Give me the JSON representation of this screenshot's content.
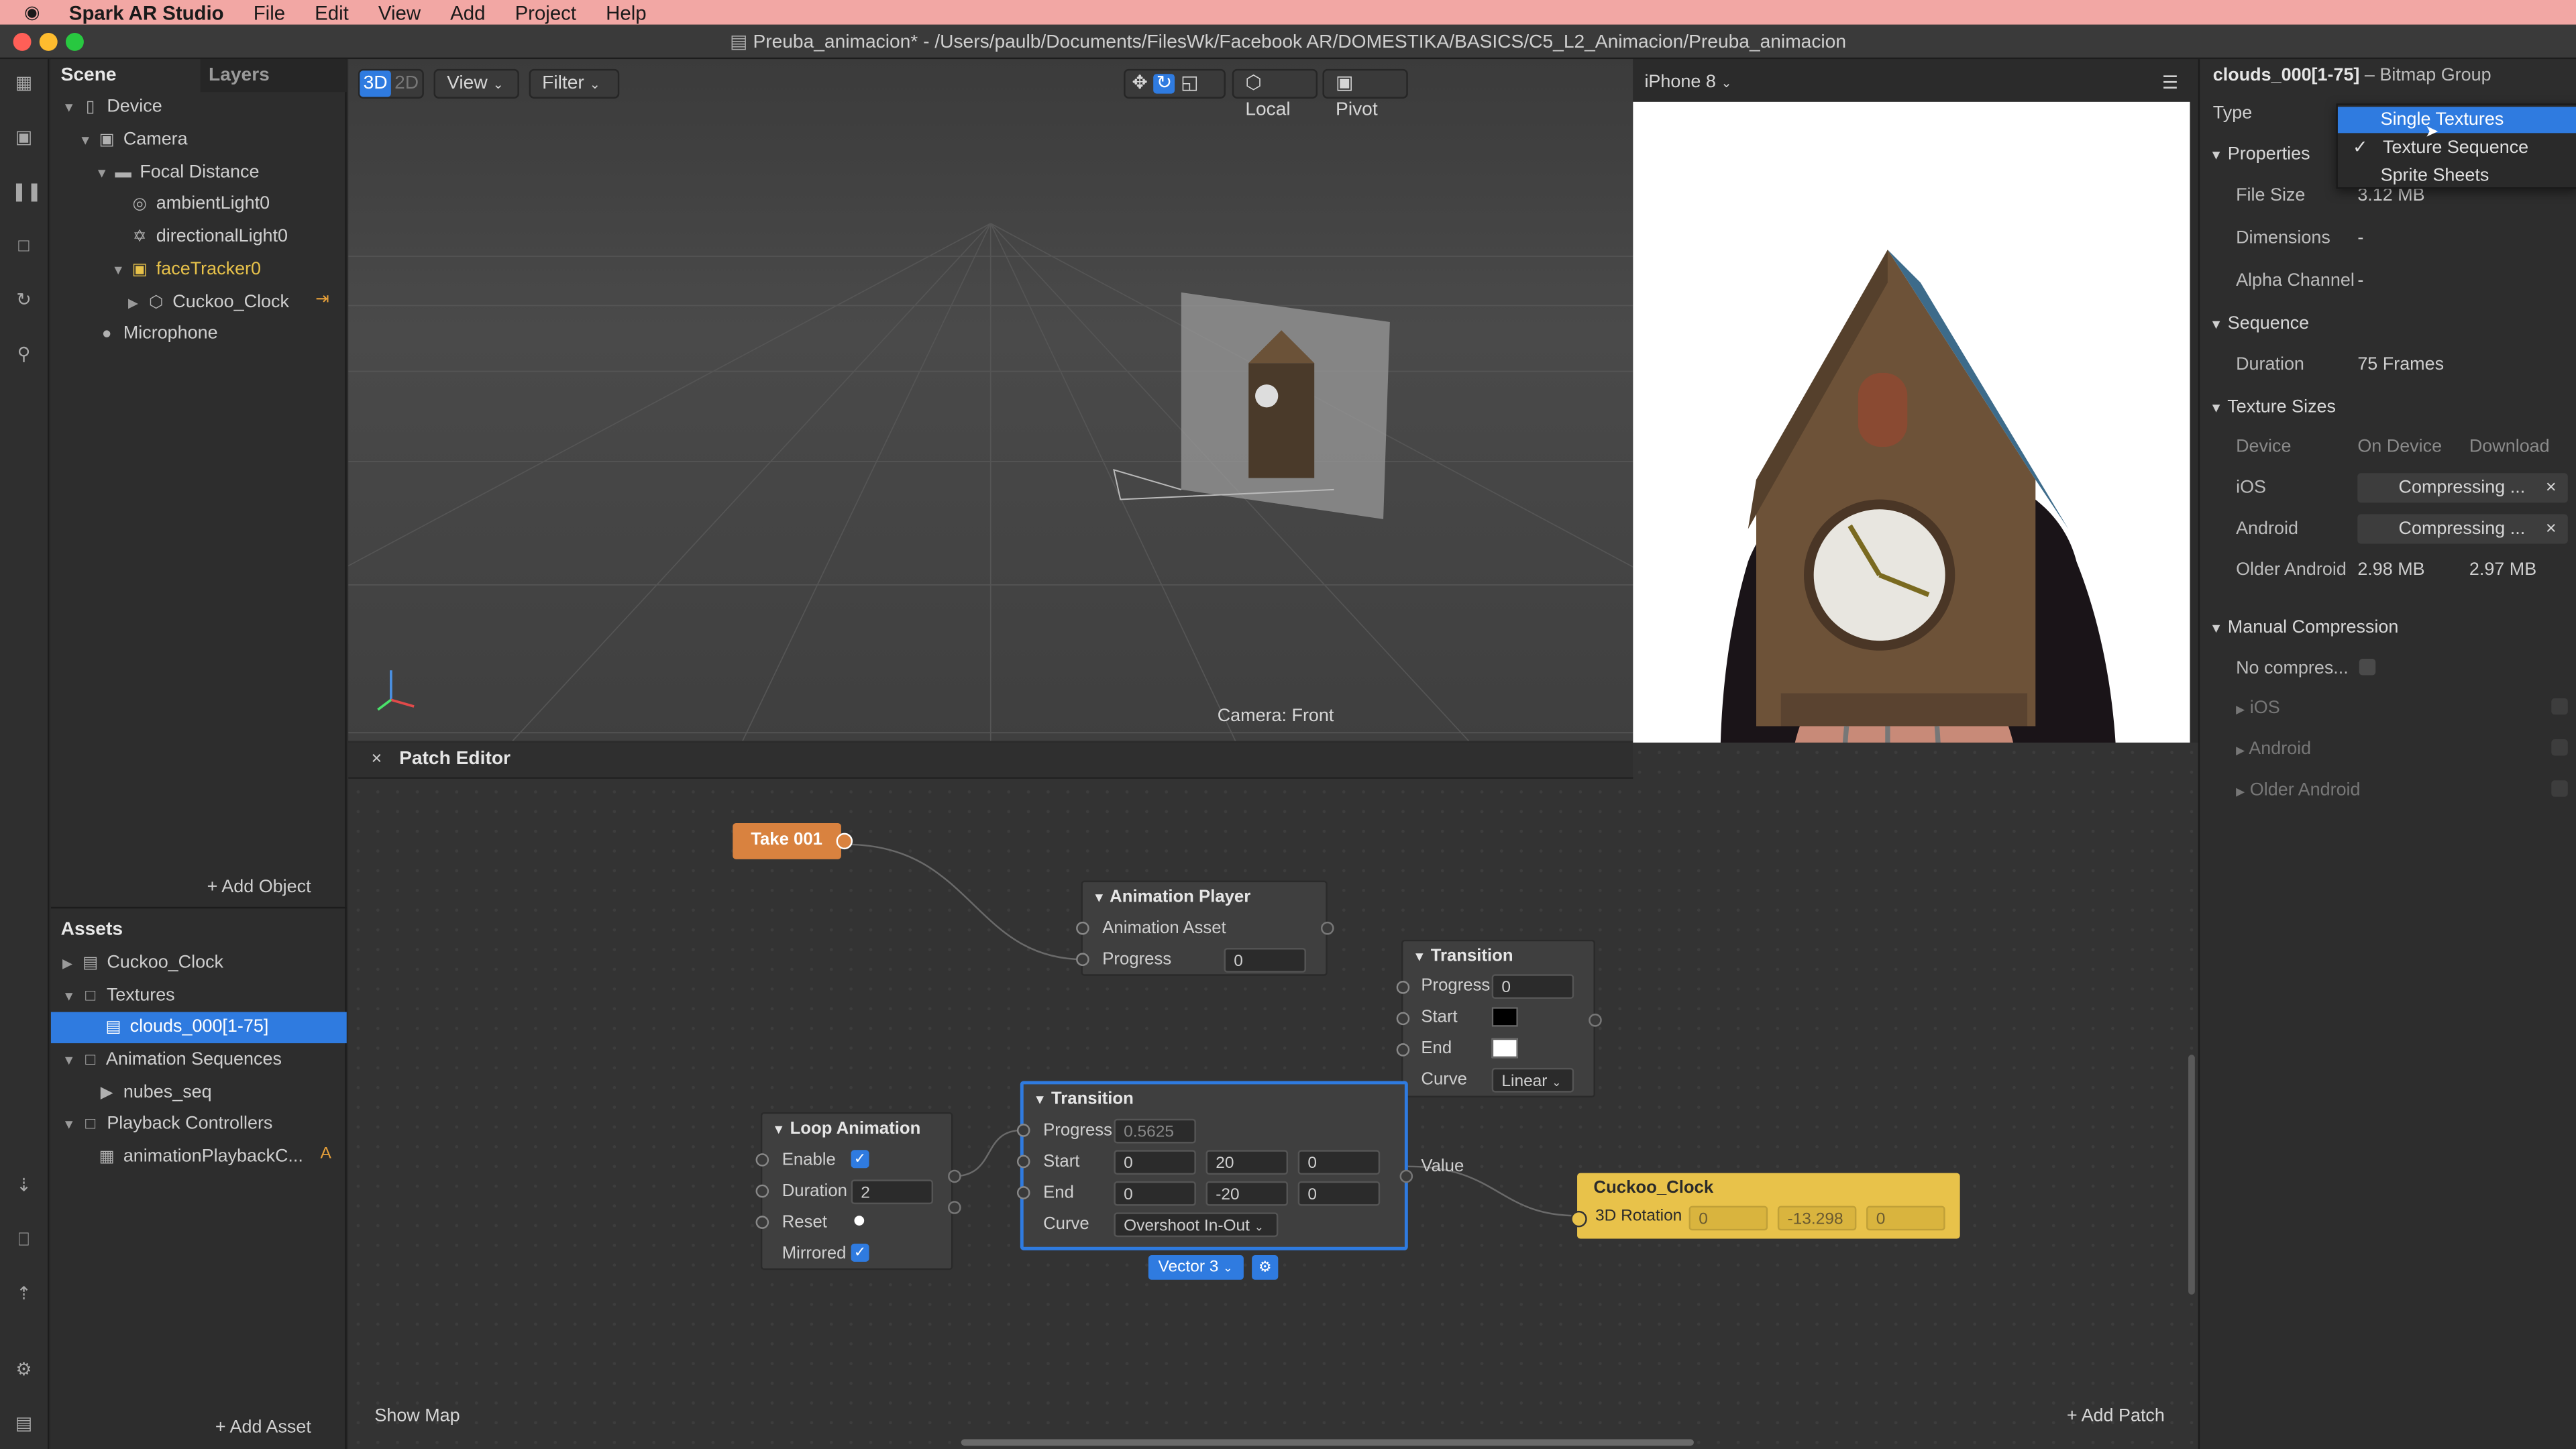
{
  "menubar": {
    "app": "Spark AR Studio",
    "items": [
      "File",
      "Edit",
      "View",
      "Add",
      "Project",
      "Help"
    ]
  },
  "window": {
    "title": "Preuba_animacion* - /Users/paulb/Documents/FilesWk/Facebook AR/DOMESTIKA/BASICS/C5_L2_Animacion/Preuba_animacion"
  },
  "scene_panel": {
    "tabs": [
      "Scene",
      "Layers"
    ],
    "tree": [
      "Device",
      "Camera",
      "Focal Distance",
      "ambientLight0",
      "directionalLight0",
      "faceTracker0",
      "Cuckoo_Clock",
      "Microphone"
    ],
    "add_object": "+ Add Object"
  },
  "assets_panel": {
    "title": "Assets",
    "tree": [
      "Cuckoo_Clock",
      "Textures",
      "clouds_000[1-75]",
      "Animation Sequences",
      "nubes_seq",
      "Playback Controllers",
      "animationPlaybackC..."
    ],
    "badge": "A",
    "add_asset": "+ Add Asset"
  },
  "viewport": {
    "mode_3d": "3D",
    "mode_2d": "2D",
    "view": "View",
    "filter": "Filter",
    "local": "Local",
    "pivot": "Pivot",
    "camera_label": "Camera: Front"
  },
  "preview": {
    "device": "iPhone 8"
  },
  "patch_editor": {
    "title": "Patch Editor",
    "show_map": "Show Map",
    "add_patch": "+ Add Patch",
    "take": "Take 001",
    "animation_player": {
      "title": "Animation Player",
      "asset": "Animation Asset",
      "progress_label": "Progress",
      "progress": "0"
    },
    "transition_color": {
      "title": "Transition",
      "progress_label": "Progress",
      "progress": "0",
      "start": "Start",
      "end": "End",
      "curve_label": "Curve",
      "curve": "Linear"
    },
    "loop_animation": {
      "title": "Loop Animation",
      "enable": "Enable",
      "duration_label": "Duration",
      "duration": "2",
      "reset": "Reset",
      "mirrored": "Mirrored"
    },
    "transition_vec": {
      "title": "Transition",
      "progress_label": "Progress",
      "progress": "0.5625",
      "start": "Start",
      "start_x": "0",
      "start_y": "20",
      "start_z": "0",
      "end": "End",
      "end_x": "0",
      "end_y": "-20",
      "end_z": "0",
      "curve_label": "Curve",
      "curve": "Overshoot In-Out",
      "type": "Vector 3"
    },
    "value_label": "Value",
    "cuckoo": {
      "title": "Cuckoo_Clock",
      "prop": "3D Rotation",
      "x": "0",
      "y": "-13.298",
      "z": "0"
    }
  },
  "properties": {
    "title": "clouds_000[1-75]",
    "subtitle": "– Bitmap Group",
    "type_label": "Type",
    "dropdown": [
      "Single Textures",
      "Texture Sequence",
      "Sprite Sheets"
    ],
    "properties_section": "Properties",
    "file_size_label": "File Size",
    "file_size": "3.12 MB",
    "dimensions_label": "Dimensions",
    "dimensions": "-",
    "alpha_label": "Alpha Channel",
    "alpha": "-",
    "sequence_section": "Sequence",
    "duration_label": "Duration",
    "duration": "75 Frames",
    "texture_sizes": "Texture Sizes",
    "col_device": "Device",
    "col_on_device": "On Device",
    "col_download": "Download",
    "ios": "iOS",
    "android": "Android",
    "compressing": "Compressing ...",
    "older_android": "Older Android",
    "older_on_device": "2.98 MB",
    "older_download": "2.97 MB",
    "manual_compression": "Manual Compression",
    "no_compress": "No compres...",
    "sub_ios": "iOS",
    "sub_android": "Android",
    "sub_older": "Older Android"
  },
  "colors": {
    "accent": "#2f7be0",
    "take": "#d9823f",
    "cuckoo_node": "#e8c24a",
    "menubar": "#f2a7a4",
    "logo": "#e31e24"
  }
}
